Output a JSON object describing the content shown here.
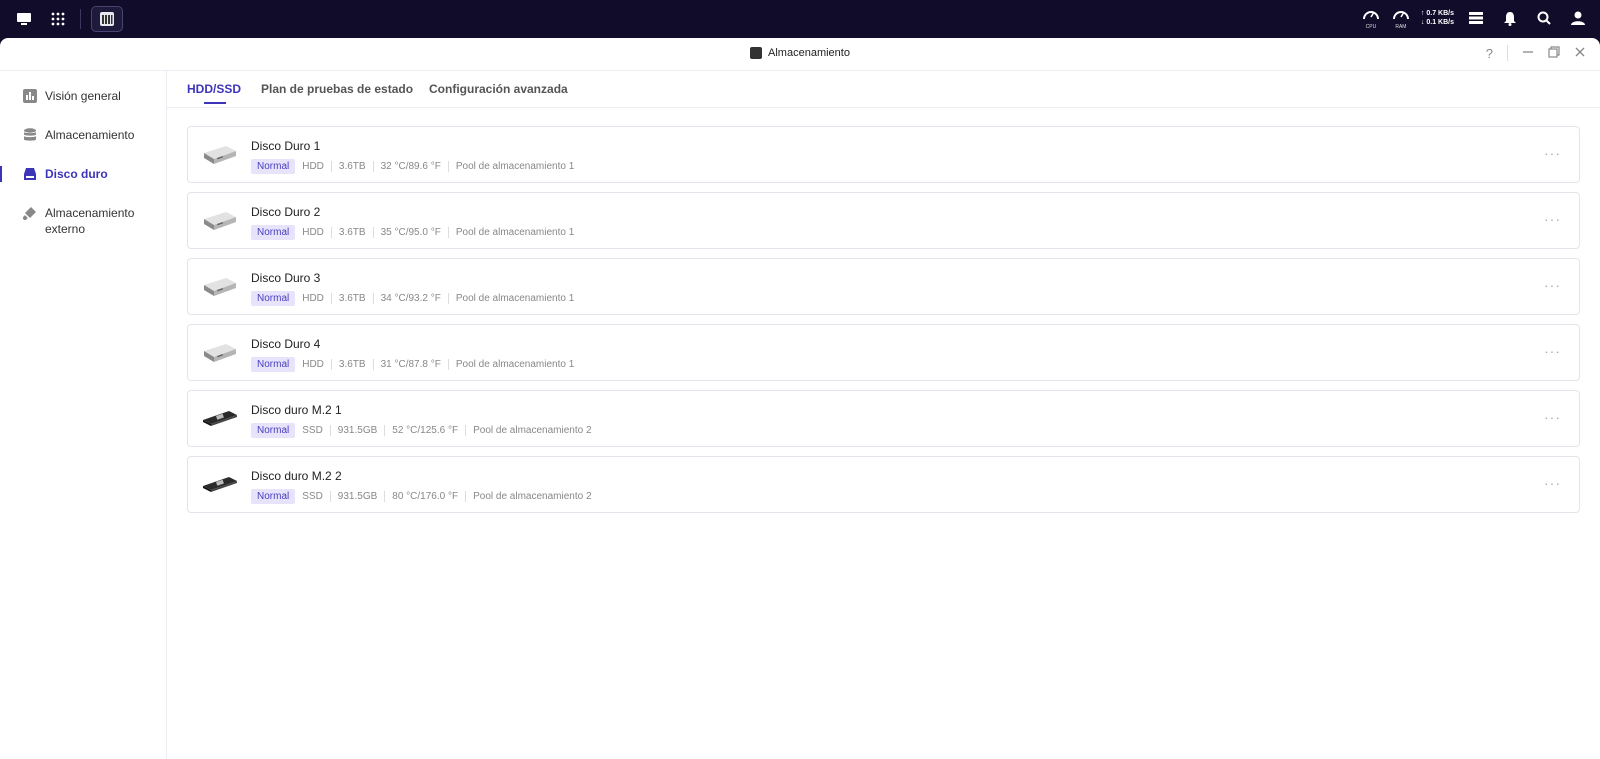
{
  "topbar": {
    "cpu_label": "CPU",
    "ram_label": "RAM",
    "net_up": "0.7 KB/s",
    "net_down": "0.1 KB/s"
  },
  "window": {
    "title": "Almacenamiento",
    "help": "?"
  },
  "sidebar": {
    "items": [
      {
        "label": "Visión general",
        "icon": "chart-icon"
      },
      {
        "label": "Almacenamiento",
        "icon": "database-icon"
      },
      {
        "label": "Disco duro",
        "icon": "disk-icon",
        "active": true
      },
      {
        "label": "Almacenamiento externo",
        "icon": "usb-icon"
      }
    ]
  },
  "tabs": [
    {
      "label": "HDD/SSD",
      "active": true
    },
    {
      "label": "Plan de pruebas de estado"
    },
    {
      "label": "Configuración avanzada"
    }
  ],
  "disks": [
    {
      "name": "Disco Duro 1",
      "status": "Normal",
      "type": "HDD",
      "size": "3.6TB",
      "temp": "32 °C/89.6 °F",
      "pool": "Pool de almacenamiento 1",
      "kind": "hdd"
    },
    {
      "name": "Disco Duro 2",
      "status": "Normal",
      "type": "HDD",
      "size": "3.6TB",
      "temp": "35 °C/95.0 °F",
      "pool": "Pool de almacenamiento 1",
      "kind": "hdd"
    },
    {
      "name": "Disco Duro 3",
      "status": "Normal",
      "type": "HDD",
      "size": "3.6TB",
      "temp": "34 °C/93.2 °F",
      "pool": "Pool de almacenamiento 1",
      "kind": "hdd"
    },
    {
      "name": "Disco Duro 4",
      "status": "Normal",
      "type": "HDD",
      "size": "3.6TB",
      "temp": "31 °C/87.8 °F",
      "pool": "Pool de almacenamiento 1",
      "kind": "hdd"
    },
    {
      "name": "Disco duro M.2 1",
      "status": "Normal",
      "type": "SSD",
      "size": "931.5GB",
      "temp": "52 °C/125.6 °F",
      "pool": "Pool de almacenamiento 2",
      "kind": "m2"
    },
    {
      "name": "Disco duro M.2 2",
      "status": "Normal",
      "type": "SSD",
      "size": "931.5GB",
      "temp": "80 °C/176.0 °F",
      "pool": "Pool de almacenamiento 2",
      "kind": "m2"
    }
  ],
  "more_label": "···",
  "colors": {
    "accent": "#3d35b8",
    "topbar": "#100c2a",
    "badge_bg": "#e6e3fa"
  }
}
